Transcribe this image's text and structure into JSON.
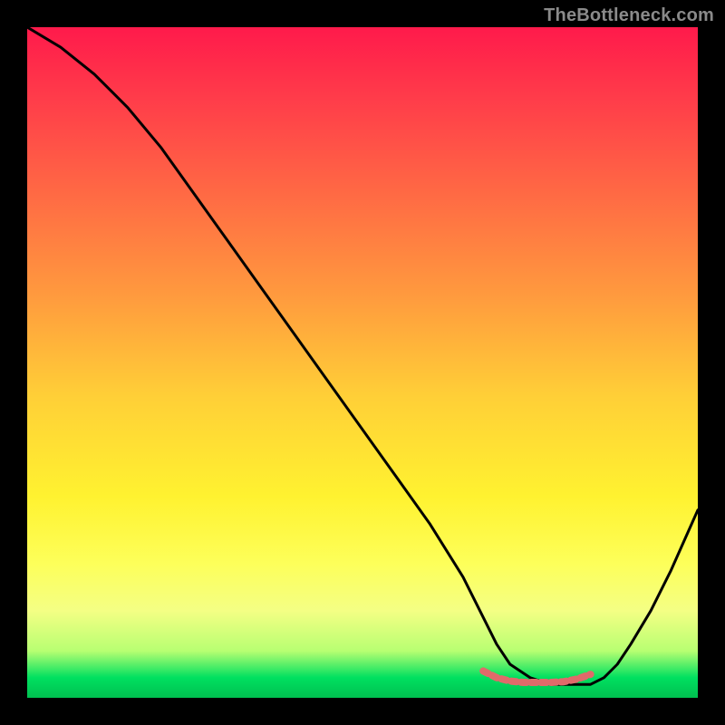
{
  "watermark": "TheBottleneck.com",
  "chart_data": {
    "type": "line",
    "title": "",
    "xlabel": "",
    "ylabel": "",
    "xlim": [
      0,
      100
    ],
    "ylim": [
      0,
      100
    ],
    "grid": false,
    "legend": false,
    "series": [
      {
        "name": "black-curve",
        "color": "#000000",
        "x": [
          0,
          5,
          10,
          15,
          20,
          25,
          30,
          35,
          40,
          45,
          50,
          55,
          60,
          65,
          68,
          70,
          72,
          75,
          78,
          80,
          82,
          84,
          86,
          88,
          90,
          93,
          96,
          100
        ],
        "values": [
          100,
          97,
          93,
          88,
          82,
          75,
          68,
          61,
          54,
          47,
          40,
          33,
          26,
          18,
          12,
          8,
          5,
          3,
          2,
          2,
          2,
          2,
          3,
          5,
          8,
          13,
          19,
          28
        ]
      },
      {
        "name": "red-band",
        "color": "#e06a6a",
        "x": [
          68,
          70,
          72,
          74,
          76,
          78,
          80,
          82,
          84
        ],
        "values": [
          4,
          3,
          2.5,
          2.3,
          2.3,
          2.3,
          2.4,
          2.8,
          3.5
        ]
      }
    ],
    "annotations": []
  }
}
